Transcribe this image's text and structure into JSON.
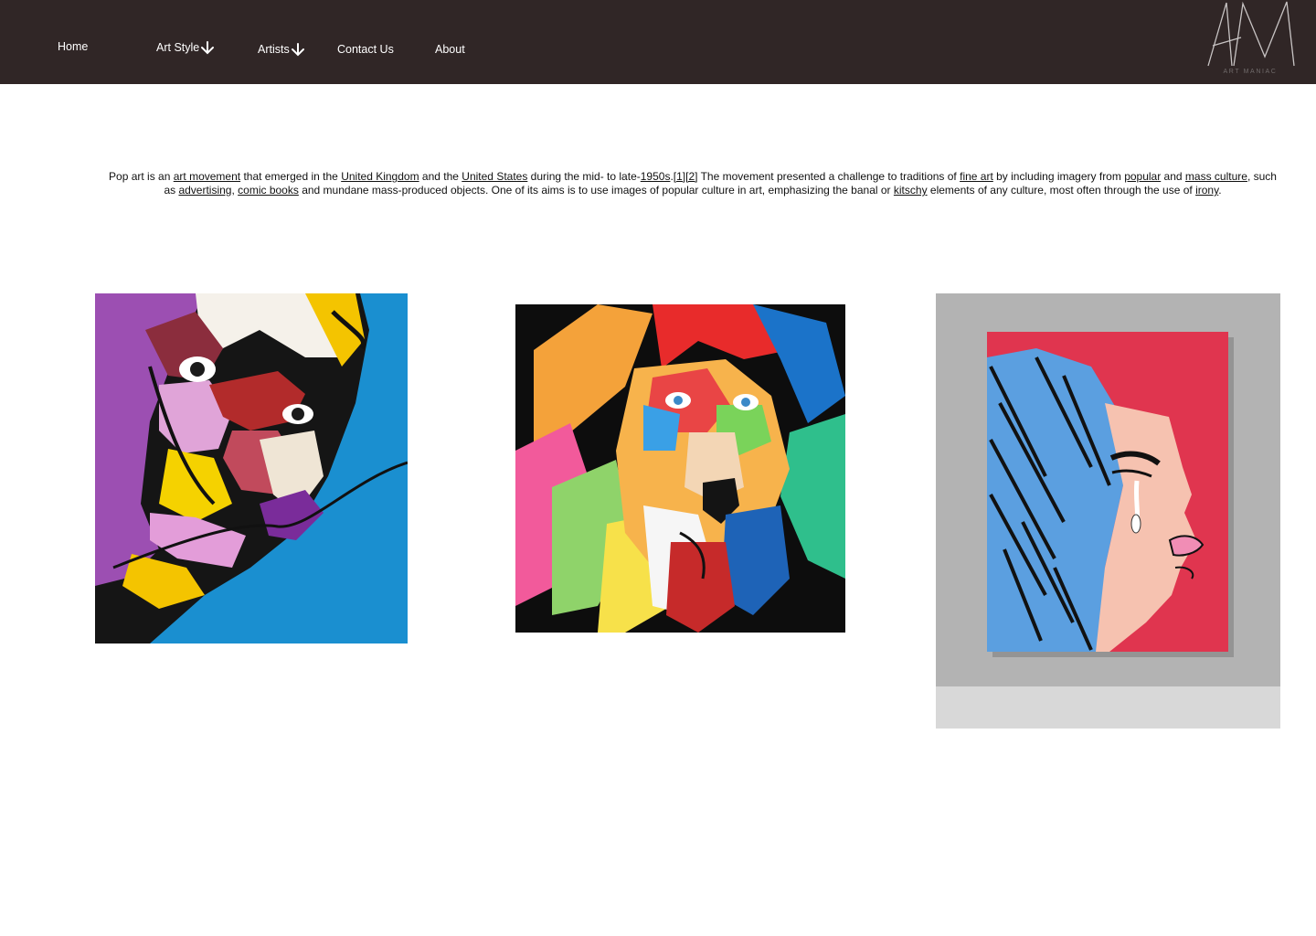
{
  "nav": {
    "home": "Home",
    "art_style": "Art Style",
    "artists": "Artists",
    "contact": "Contact Us",
    "about": "About"
  },
  "logo": {
    "mark": "AM",
    "subtitle": "ART MANIAC"
  },
  "intro": {
    "t1": "Pop art is an ",
    "l1": "art movement",
    "t2": " that emerged in the ",
    "l2": "United Kingdom",
    "t3": " and the ",
    "l3": "United States",
    "t4": " during the mid- to late-",
    "l4": "1950s",
    "t5": ".",
    "l5": "[1]",
    "l6": "[2]",
    "t6": " The movement presented a challenge to traditions of ",
    "l7": "fine art",
    "t7": " by including imagery from ",
    "l8": "popular",
    "t8": " and ",
    "l9": "mass culture",
    "t9": ", such as ",
    "l10": "advertising",
    "t10": ", ",
    "l11": "comic books",
    "t11": " and mundane mass-produced objects. One of its aims is to use images of popular culture in art, emphasizing the banal or ",
    "l12": "kitschy",
    "t12": " elements of any culture, most often through the use of ",
    "l13": "irony",
    "t13": "."
  },
  "gallery": [
    {
      "subject": "surreal-mustache-portrait"
    },
    {
      "subject": "rainbow-lion"
    },
    {
      "subject": "crying-comic-girl"
    }
  ],
  "colors": {
    "nav_bg": "#302626",
    "nav_text": "#ffffff",
    "body_text": "#111111"
  }
}
